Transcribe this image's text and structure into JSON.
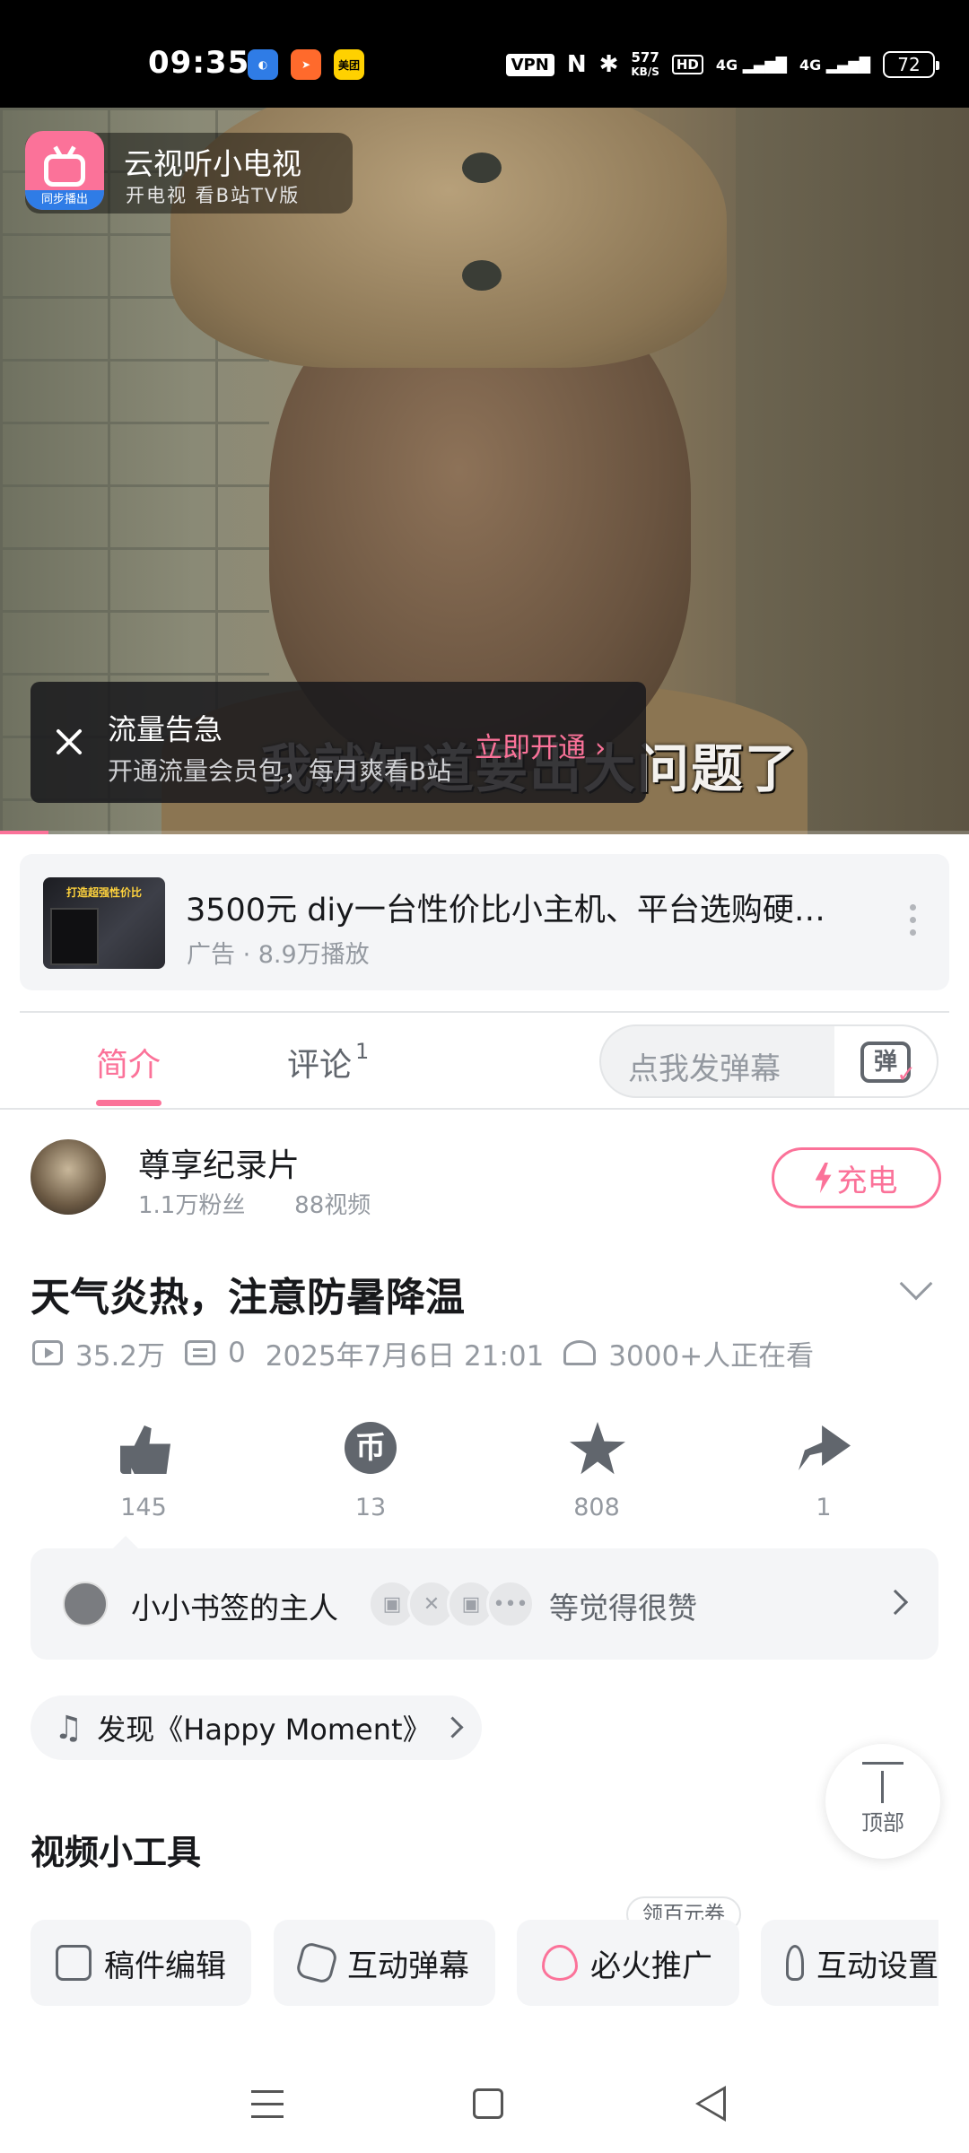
{
  "status_bar": {
    "time": "09:35",
    "apps": [
      {
        "icon": "app-icon-blue",
        "color": "#2f7ce6"
      },
      {
        "icon": "app-icon-orange",
        "color": "#ff6a2c"
      },
      {
        "icon": "meituan-icon",
        "label": "美团",
        "color": "#ffd100"
      }
    ],
    "vpn": "VPN",
    "nfc": "N",
    "bluetooth": "✱",
    "speed_value": "577",
    "speed_unit": "KB/S",
    "hd": "HD",
    "signal1": "4G",
    "signal2": "4G",
    "battery": "72"
  },
  "player": {
    "tv_badge_title": "云视听小电视",
    "tv_badge_subtitle": "开电视 看B站TV版",
    "tv_badge_sync": "同步播出",
    "subtitle": "我就知道要出大问题了",
    "toast_title": "流量告急",
    "toast_subtitle": "开通流量会员包，每月爽看B站",
    "toast_cta": "立即开通 ›",
    "progress": 0.05,
    "accent": "#fb7299"
  },
  "ad": {
    "thumb_text": "打造超强性价比",
    "title": "3500元 diy一台性价比小主机、平台选购硬…",
    "meta": "广告 · 8.9万播放"
  },
  "tabs": {
    "intro": "简介",
    "comments": "评论",
    "comments_count": "1",
    "danmaku_placeholder": "点我发弹幕",
    "danmaku_icon_text": "弹"
  },
  "uploader": {
    "name": "尊享纪录片",
    "followers": "1.1万粉丝",
    "videos": "88视频",
    "charge_label": "充电"
  },
  "video": {
    "title": "天气炎热，注意防暑降温",
    "plays": "35.2万",
    "danmaku": "0",
    "date": "2025年7月6日 21:01",
    "watching": "3000+人正在看"
  },
  "actions": {
    "like": "145",
    "coin": "13",
    "coin_glyph": "币",
    "favorite": "808",
    "share": "1"
  },
  "likers": {
    "name": "小小书签的主人",
    "suffix": "等觉得很赞",
    "more": "•••"
  },
  "music": {
    "label": "发现《Happy Moment》"
  },
  "back_to_top": "顶部",
  "tools": {
    "title": "视频小工具",
    "items": [
      "稿件编辑",
      "互动弹幕",
      "必火推广",
      "互动设置"
    ],
    "voucher": "领百元券"
  }
}
